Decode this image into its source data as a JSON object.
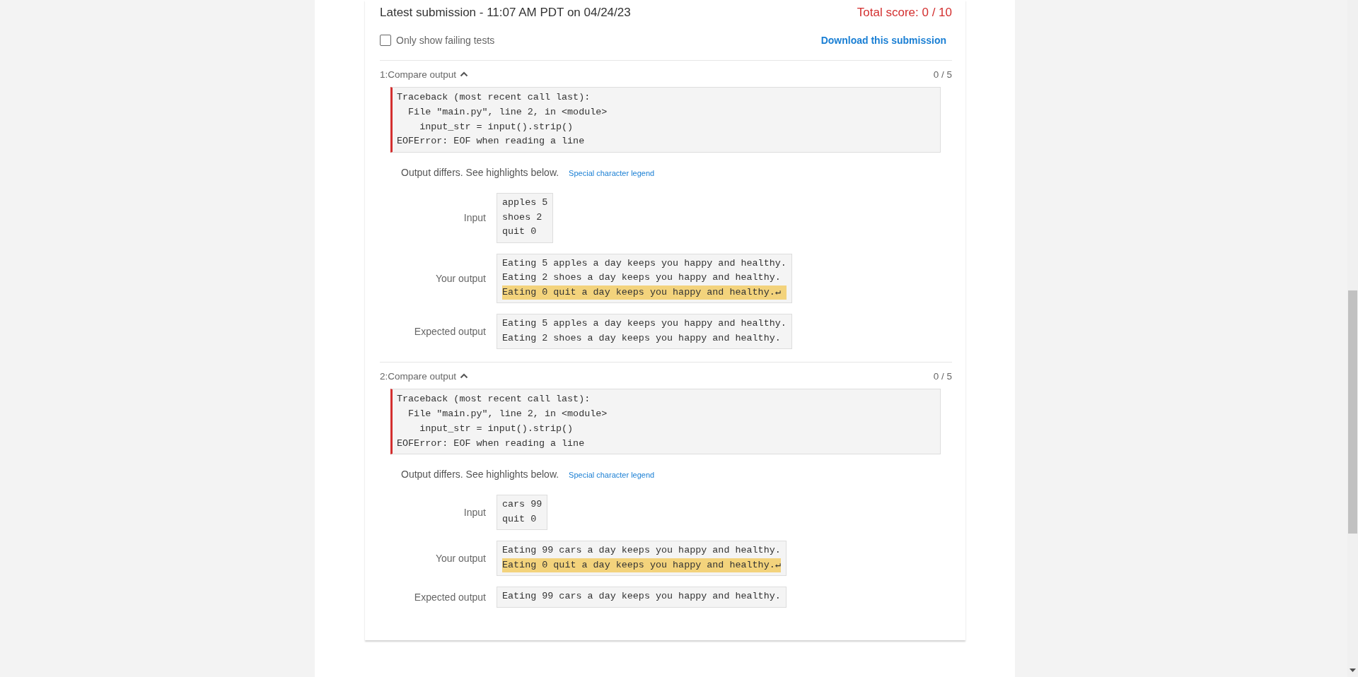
{
  "submission": {
    "title": "Latest submission - 11:07 AM PDT on 04/24/23",
    "total_score": "Total score: 0 / 10"
  },
  "filter": {
    "label": "Only show failing tests",
    "checked": false
  },
  "download_link": "Download this submission",
  "tests": [
    {
      "title": "1:Compare output",
      "expanded": true,
      "score": "0 / 5",
      "error_lines": [
        "Traceback (most recent call last):",
        "  File \"main.py\", line 2, in <module>",
        "    input_str = input().strip()",
        "EOFError: EOF when reading a line"
      ],
      "message": "Output differs. See highlights below.",
      "legend_link": "Special character legend",
      "rows": [
        {
          "label": "Input",
          "lines": [
            {
              "text": "apples 5",
              "highlighted": false
            },
            {
              "text": "shoes 2",
              "highlighted": false
            },
            {
              "text": "quit 0",
              "highlighted": false
            }
          ]
        },
        {
          "label": "Your output",
          "lines": [
            {
              "text": "Eating 5 apples a day keeps you happy and healthy.",
              "highlighted": false
            },
            {
              "text": "Eating 2 shoes a day keeps you happy and healthy.",
              "highlighted": false
            },
            {
              "text": "Eating 0 quit a day keeps you happy and healthy.↵",
              "highlighted": true
            }
          ]
        },
        {
          "label": "Expected output",
          "lines": [
            {
              "text": "Eating 5 apples a day keeps you happy and healthy.",
              "highlighted": false
            },
            {
              "text": "Eating 2 shoes a day keeps you happy and healthy.",
              "highlighted": false
            }
          ]
        }
      ]
    },
    {
      "title": "2:Compare output",
      "expanded": true,
      "score": "0 / 5",
      "error_lines": [
        "Traceback (most recent call last):",
        "  File \"main.py\", line 2, in <module>",
        "    input_str = input().strip()",
        "EOFError: EOF when reading a line"
      ],
      "message": "Output differs. See highlights below.",
      "legend_link": "Special character legend",
      "rows": [
        {
          "label": "Input",
          "lines": [
            {
              "text": "cars 99",
              "highlighted": false
            },
            {
              "text": "quit 0",
              "highlighted": false
            }
          ]
        },
        {
          "label": "Your output",
          "lines": [
            {
              "text": "Eating 99 cars a day keeps you happy and healthy.",
              "highlighted": false
            },
            {
              "text": "Eating 0 quit a day keeps you happy and healthy.↵",
              "highlighted": true
            }
          ]
        },
        {
          "label": "Expected output",
          "lines": [
            {
              "text": "Eating 99 cars a day keeps you happy and healthy.",
              "highlighted": false
            }
          ]
        }
      ]
    }
  ]
}
